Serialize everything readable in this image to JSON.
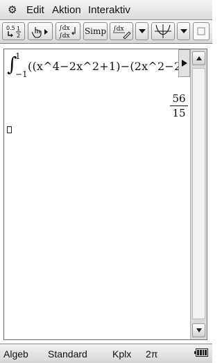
{
  "menu": {
    "items": [
      "Edit",
      "Aktion",
      "Interaktiv"
    ]
  },
  "toolbar": {
    "buttons": [
      {
        "name": "decimal-fraction-toggle"
      },
      {
        "name": "pen-cursor"
      },
      {
        "name": "integral-view"
      },
      {
        "label": "Simp"
      },
      {
        "name": "integral-pen"
      },
      {
        "name": "dropdown-1"
      },
      {
        "name": "graph"
      },
      {
        "name": "dropdown-2"
      },
      {
        "name": "fullscreen"
      }
    ]
  },
  "work": {
    "integral_symbol": "∫",
    "upper_limit": "1",
    "lower_limit": "−1",
    "expression": "((x^4−2x^2+1)−(2x^2−2",
    "result": {
      "numerator": "56",
      "denominator": "15"
    }
  },
  "status": {
    "mode": "Algeb",
    "format": "Standard",
    "complex": "Kplx",
    "angle": "2π"
  }
}
